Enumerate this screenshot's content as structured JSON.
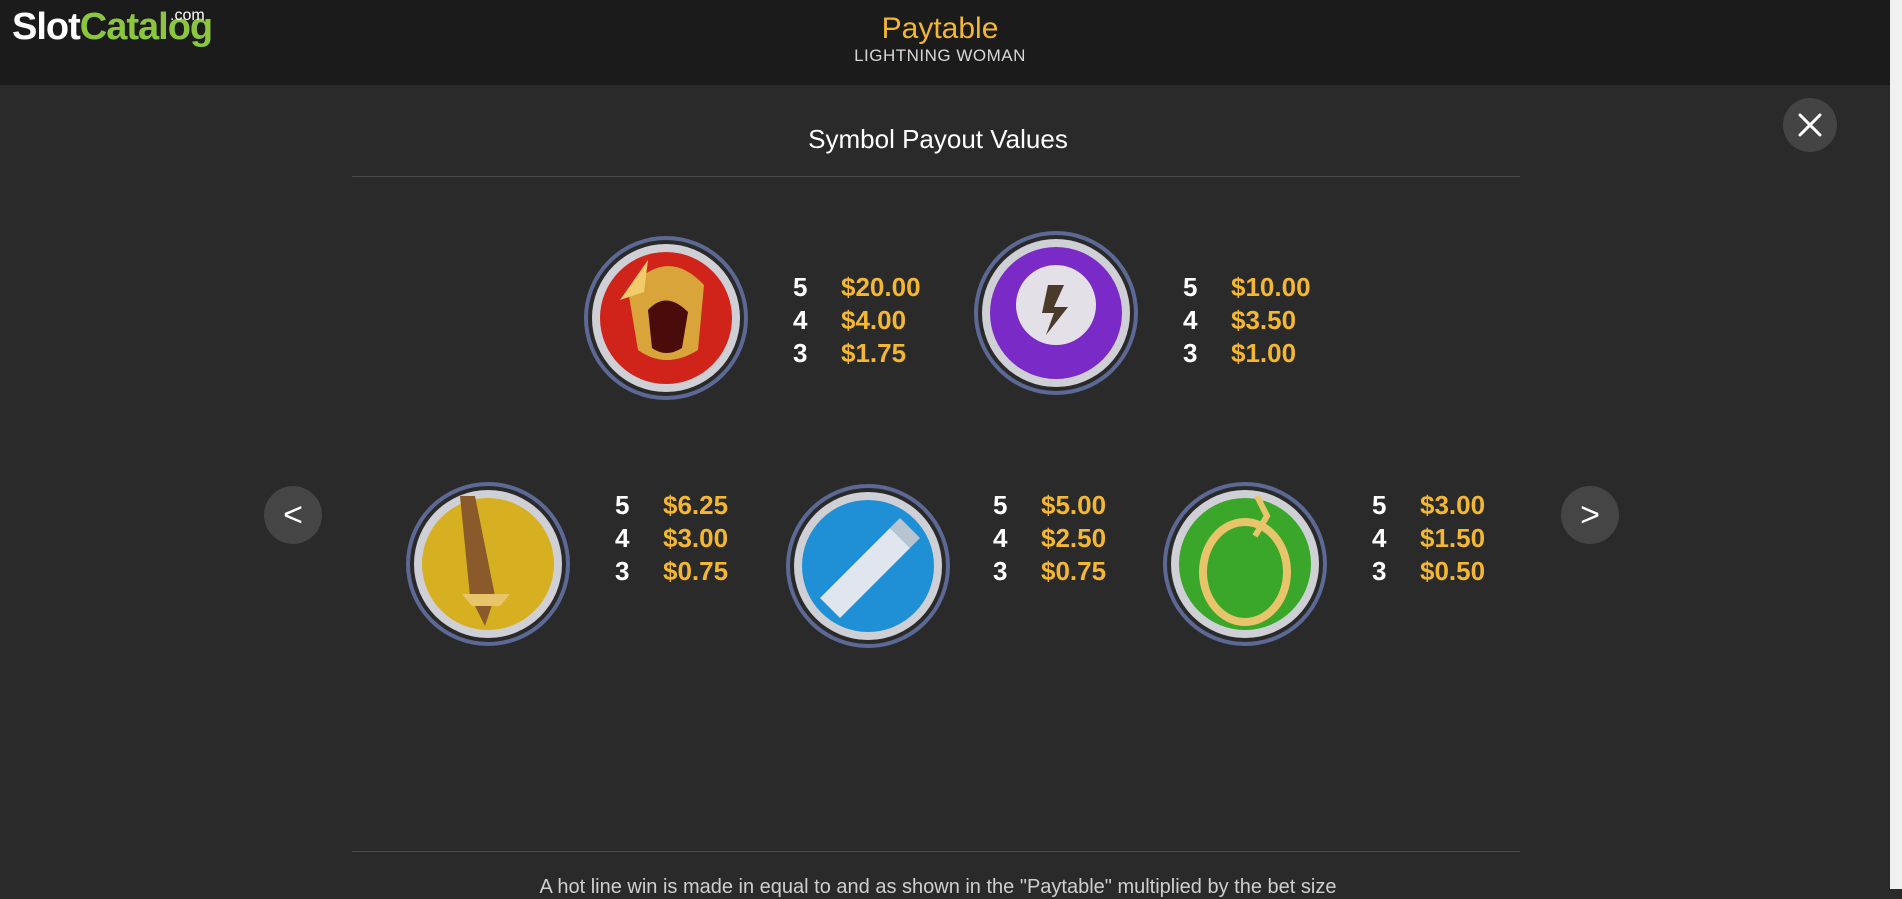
{
  "header": {
    "logo_part1": "Slot",
    "logo_part2": "Catalog",
    "logo_com": ".com",
    "title": "Paytable",
    "subtitle": "LIGHTNING WOMAN"
  },
  "section_title": "Symbol Payout Values",
  "nav": {
    "prev_label": "<",
    "next_label": ">"
  },
  "symbols": [
    {
      "icon": "helmet-icon",
      "color": "#d0241a",
      "payouts": [
        {
          "count": "5",
          "value": "$20.00"
        },
        {
          "count": "4",
          "value": "$4.00"
        },
        {
          "count": "3",
          "value": "$1.75"
        }
      ]
    },
    {
      "icon": "emblem-icon",
      "color": "#7a2bc7",
      "payouts": [
        {
          "count": "5",
          "value": "$10.00"
        },
        {
          "count": "4",
          "value": "$3.50"
        },
        {
          "count": "3",
          "value": "$1.00"
        }
      ]
    },
    {
      "icon": "sword-icon",
      "color": "#d6b021",
      "payouts": [
        {
          "count": "5",
          "value": "$6.25"
        },
        {
          "count": "4",
          "value": "$3.00"
        },
        {
          "count": "3",
          "value": "$0.75"
        }
      ]
    },
    {
      "icon": "bracer-icon",
      "color": "#1f8fd6",
      "payouts": [
        {
          "count": "5",
          "value": "$5.00"
        },
        {
          "count": "4",
          "value": "$2.50"
        },
        {
          "count": "3",
          "value": "$0.75"
        }
      ]
    },
    {
      "icon": "lasso-icon",
      "color": "#3aa62a",
      "payouts": [
        {
          "count": "5",
          "value": "$3.00"
        },
        {
          "count": "4",
          "value": "$1.50"
        },
        {
          "count": "3",
          "value": "$0.50"
        }
      ]
    }
  ],
  "footer_text": "A hot line win is made in equal to and as shown in the \"Paytable\" multiplied by the bet size"
}
